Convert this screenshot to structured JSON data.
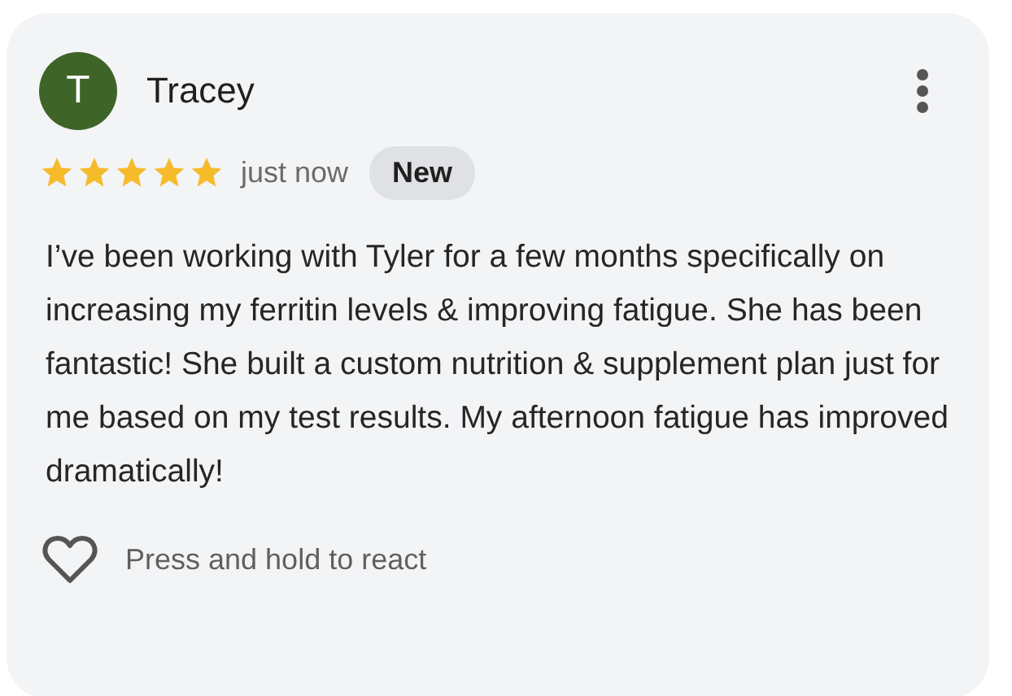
{
  "review": {
    "avatar_initial": "T",
    "author": "Tracey",
    "stars": 5,
    "time": "just now",
    "badge": "New",
    "text": "I’ve been working with Tyler for a few months specifically on increasing my ferritin levels & improving fatigue. She has been fantastic! She built a custom nutrition & supplement plan just for me based on my test results. My afternoon fatigue has improved dramatically!",
    "react_hint": "Press and hold to react"
  }
}
